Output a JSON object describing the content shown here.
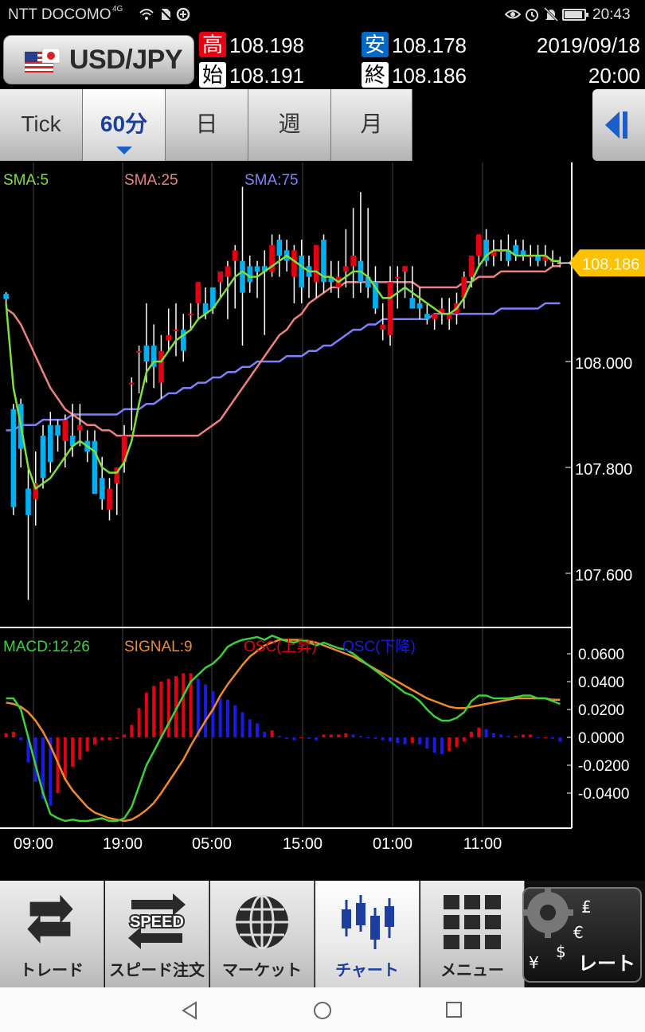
{
  "status_bar": {
    "carrier": "NTT DOCOMO",
    "network_badge": "4G",
    "time": "20:43",
    "icons": [
      "wifi-calling-icon",
      "wifi-icon",
      "no-sim-icon",
      "data-saver-icon",
      "eye-icon",
      "alarm-icon",
      "mute-icon",
      "battery-icon"
    ]
  },
  "header": {
    "pair": "USD/JPY",
    "high_label": "高",
    "high_value": "108.198",
    "low_label": "安",
    "low_value": "108.178",
    "open_label": "始",
    "open_value": "108.191",
    "close_label": "終",
    "close_value": "108.186",
    "date": "2019/09/18",
    "time": "20:00"
  },
  "tabs": [
    {
      "label": "Tick",
      "active": false
    },
    {
      "label": "60分",
      "active": true
    },
    {
      "label": "日",
      "active": false
    },
    {
      "label": "週",
      "active": false
    },
    {
      "label": "月",
      "active": false
    }
  ],
  "chart_data": {
    "type": "candlestick",
    "symbol": "USD/JPY",
    "interval": "60分",
    "legend": [
      "SMA:5",
      "SMA:25",
      "SMA:75"
    ],
    "legend_colors": [
      "#7ee03a",
      "#f08080",
      "#8080ff"
    ],
    "current_price": "108.186",
    "current_price_color": "#ffc000",
    "yticks": [
      "108.000",
      "107.800",
      "107.600"
    ],
    "ylim": [
      107.5,
      108.35
    ],
    "xticks": [
      "09:00",
      "19:00",
      "05:00",
      "15:00",
      "01:00",
      "11:00"
    ],
    "up_color": "#e60012",
    "down_color": "#00b0f0",
    "candles": [
      [
        108.128,
        108.131,
        108.11,
        108.118
      ],
      [
        107.91,
        107.92,
        107.71,
        107.725
      ],
      [
        107.92,
        107.93,
        107.8,
        107.835
      ],
      [
        107.76,
        107.8,
        107.55,
        107.71
      ],
      [
        107.74,
        107.83,
        107.69,
        107.77
      ],
      [
        107.86,
        107.88,
        107.76,
        107.78
      ],
      [
        107.88,
        107.905,
        107.79,
        107.81
      ],
      [
        107.88,
        107.89,
        107.83,
        107.86
      ],
      [
        107.85,
        107.9,
        107.8,
        107.89
      ],
      [
        107.86,
        107.92,
        107.82,
        107.84
      ],
      [
        107.87,
        107.92,
        107.84,
        107.88
      ],
      [
        107.85,
        107.87,
        107.81,
        107.83
      ],
      [
        107.85,
        107.87,
        107.75,
        107.75
      ],
      [
        107.78,
        107.82,
        107.72,
        107.74
      ],
      [
        107.72,
        107.78,
        107.7,
        107.76
      ],
      [
        107.77,
        107.8,
        107.71,
        107.8
      ],
      [
        107.81,
        107.88,
        107.79,
        107.86
      ],
      [
        107.96,
        107.97,
        107.87,
        107.96
      ],
      [
        108.02,
        108.03,
        107.94,
        108.02
      ],
      [
        108.03,
        108.11,
        107.96,
        108.0
      ],
      [
        108.03,
        108.07,
        107.95,
        107.99
      ],
      [
        107.96,
        108.05,
        107.93,
        108.02
      ],
      [
        108.04,
        108.1,
        108.02,
        108.05
      ],
      [
        108.06,
        108.11,
        108.01,
        108.06
      ],
      [
        108.06,
        108.09,
        108.0,
        108.02
      ],
      [
        108.09,
        108.11,
        108.06,
        108.09
      ],
      [
        108.11,
        108.15,
        108.08,
        108.15
      ],
      [
        108.11,
        108.14,
        108.08,
        108.09
      ],
      [
        108.14,
        108.14,
        108.09,
        108.1
      ],
      [
        108.15,
        108.17,
        108.12,
        108.17
      ],
      [
        108.16,
        108.19,
        108.08,
        108.18
      ],
      [
        108.19,
        108.22,
        108.1,
        108.21
      ],
      [
        108.19,
        108.33,
        108.03,
        108.13
      ],
      [
        108.18,
        108.2,
        108.13,
        108.15
      ],
      [
        108.18,
        108.19,
        108.12,
        108.17
      ],
      [
        108.18,
        108.21,
        108.05,
        108.17
      ],
      [
        108.17,
        108.24,
        108.16,
        108.22
      ],
      [
        108.23,
        108.24,
        108.16,
        108.2
      ],
      [
        108.21,
        108.23,
        108.17,
        108.19
      ],
      [
        108.16,
        108.22,
        108.11,
        108.21
      ],
      [
        108.2,
        108.23,
        108.11,
        108.14
      ],
      [
        108.18,
        108.2,
        108.12,
        108.16
      ],
      [
        108.15,
        108.22,
        108.12,
        108.22
      ],
      [
        108.23,
        108.24,
        108.13,
        108.15
      ],
      [
        108.16,
        108.19,
        108.13,
        108.15
      ],
      [
        108.14,
        108.19,
        108.12,
        108.16
      ],
      [
        108.17,
        108.25,
        108.14,
        108.18
      ],
      [
        108.18,
        108.29,
        108.12,
        108.2
      ],
      [
        108.19,
        108.32,
        108.13,
        108.15
      ],
      [
        108.16,
        108.29,
        108.12,
        108.14
      ],
      [
        108.15,
        108.18,
        108.09,
        108.1
      ],
      [
        108.06,
        108.11,
        108.04,
        108.07
      ],
      [
        108.05,
        108.18,
        108.03,
        108.15
      ],
      [
        108.16,
        108.18,
        108.1,
        108.16
      ],
      [
        108.17,
        108.18,
        108.12,
        108.18
      ],
      [
        108.12,
        108.18,
        108.1,
        108.1
      ],
      [
        108.11,
        108.14,
        108.08,
        108.1
      ],
      [
        108.09,
        108.11,
        108.07,
        108.08
      ],
      [
        108.08,
        108.09,
        108.06,
        108.09
      ],
      [
        108.09,
        108.12,
        108.07,
        108.1
      ],
      [
        108.08,
        108.12,
        108.06,
        108.09
      ],
      [
        108.09,
        108.13,
        108.07,
        108.11
      ],
      [
        108.12,
        108.17,
        108.1,
        108.16
      ],
      [
        108.16,
        108.2,
        108.14,
        108.2
      ],
      [
        108.2,
        108.24,
        108.18,
        108.24
      ],
      [
        108.23,
        108.25,
        108.18,
        108.19
      ],
      [
        108.2,
        108.23,
        108.18,
        108.21
      ],
      [
        108.21,
        108.23,
        108.19,
        108.21
      ],
      [
        108.21,
        108.24,
        108.18,
        108.19
      ],
      [
        108.22,
        108.23,
        108.19,
        108.2
      ],
      [
        108.21,
        108.23,
        108.19,
        108.2
      ],
      [
        108.2,
        108.22,
        108.18,
        108.2
      ],
      [
        108.2,
        108.22,
        108.18,
        108.19
      ],
      [
        108.19,
        108.22,
        108.18,
        108.2
      ],
      [
        108.19,
        108.21,
        108.18,
        108.19
      ],
      [
        108.186,
        108.198,
        108.178,
        108.186
      ]
    ],
    "sma5": [
      108.11,
      107.95,
      107.88,
      107.8,
      107.76,
      107.77,
      107.78,
      107.8,
      107.82,
      107.84,
      107.85,
      107.84,
      107.83,
      107.8,
      107.79,
      107.79,
      107.81,
      107.85,
      107.92,
      107.98,
      108.0,
      108.0,
      108.02,
      108.04,
      108.05,
      108.06,
      108.08,
      108.09,
      108.1,
      108.12,
      108.14,
      108.16,
      108.17,
      108.16,
      108.16,
      108.17,
      108.18,
      108.19,
      108.2,
      108.19,
      108.18,
      108.17,
      108.17,
      108.16,
      108.16,
      108.15,
      108.16,
      108.17,
      108.17,
      108.16,
      108.14,
      108.12,
      108.12,
      108.13,
      108.14,
      108.13,
      108.12,
      108.11,
      108.1,
      108.09,
      108.09,
      108.1,
      108.12,
      108.15,
      108.18,
      108.2,
      108.21,
      108.21,
      108.21,
      108.2,
      108.2,
      108.2,
      108.2,
      108.2,
      108.19,
      108.19
    ],
    "sma25": [
      108.1,
      108.09,
      108.07,
      108.04,
      108.01,
      107.98,
      107.95,
      107.93,
      107.91,
      107.9,
      107.89,
      107.88,
      107.88,
      107.87,
      107.87,
      107.86,
      107.86,
      107.86,
      107.86,
      107.86,
      107.86,
      107.86,
      107.86,
      107.86,
      107.86,
      107.86,
      107.86,
      107.87,
      107.88,
      107.89,
      107.91,
      107.93,
      107.95,
      107.97,
      107.99,
      108.01,
      108.03,
      108.05,
      108.06,
      108.08,
      108.09,
      108.11,
      108.12,
      108.13,
      108.14,
      108.14,
      108.15,
      108.15,
      108.15,
      108.15,
      108.15,
      108.15,
      108.15,
      108.15,
      108.15,
      108.15,
      108.14,
      108.14,
      108.14,
      108.14,
      108.14,
      108.14,
      108.15,
      108.15,
      108.16,
      108.16,
      108.16,
      108.17,
      108.17,
      108.17,
      108.17,
      108.17,
      108.17,
      108.17,
      108.18,
      108.18
    ],
    "sma75": [
      107.87,
      107.87,
      107.88,
      107.88,
      107.88,
      107.89,
      107.89,
      107.89,
      107.89,
      107.9,
      107.9,
      107.9,
      107.9,
      107.9,
      107.9,
      107.9,
      107.91,
      107.91,
      107.91,
      107.92,
      107.92,
      107.93,
      107.94,
      107.94,
      107.95,
      107.95,
      107.96,
      107.96,
      107.97,
      107.97,
      107.98,
      107.98,
      107.99,
      107.99,
      108.0,
      108.0,
      108.0,
      108.0,
      108.01,
      108.01,
      108.01,
      108.02,
      108.02,
      108.03,
      108.03,
      108.04,
      108.05,
      108.06,
      108.06,
      108.07,
      108.07,
      108.08,
      108.08,
      108.08,
      108.08,
      108.08,
      108.08,
      108.08,
      108.09,
      108.09,
      108.09,
      108.09,
      108.09,
      108.09,
      108.09,
      108.09,
      108.09,
      108.1,
      108.1,
      108.1,
      108.1,
      108.1,
      108.1,
      108.11,
      108.11,
      108.11
    ],
    "macd_legend": [
      "MACD:12,26",
      "SIGNAL:9",
      "OSC(上昇)",
      "OSC(下降)"
    ],
    "macd_legend_colors": [
      "#3ad13a",
      "#f08a2a",
      "#e60012",
      "#1a1ae6"
    ],
    "macd_yticks": [
      "0.0600",
      "0.0400",
      "0.0200",
      "0.0000",
      "-0.0200",
      "-0.0400"
    ],
    "macd_ylim": [
      -0.06,
      0.075
    ],
    "macd": [
      0.028,
      0.028,
      0.02,
      0.0,
      -0.02,
      -0.04,
      -0.055,
      -0.058,
      -0.06,
      -0.059,
      -0.06,
      -0.06,
      -0.059,
      -0.058,
      -0.06,
      -0.06,
      -0.058,
      -0.05,
      -0.035,
      -0.02,
      -0.01,
      0.0,
      0.01,
      0.02,
      0.03,
      0.04,
      0.045,
      0.05,
      0.053,
      0.058,
      0.065,
      0.068,
      0.07,
      0.071,
      0.072,
      0.07,
      0.073,
      0.071,
      0.069,
      0.068,
      0.07,
      0.068,
      0.066,
      0.068,
      0.066,
      0.064,
      0.063,
      0.06,
      0.056,
      0.052,
      0.048,
      0.044,
      0.04,
      0.036,
      0.032,
      0.03,
      0.026,
      0.02,
      0.015,
      0.012,
      0.012,
      0.014,
      0.018,
      0.026,
      0.03,
      0.03,
      0.028,
      0.028,
      0.028,
      0.029,
      0.03,
      0.03,
      0.028,
      0.028,
      0.026,
      0.024
    ],
    "signal": [
      0.025,
      0.024,
      0.022,
      0.018,
      0.012,
      0.004,
      -0.006,
      -0.018,
      -0.03,
      -0.038,
      -0.044,
      -0.05,
      -0.054,
      -0.056,
      -0.058,
      -0.059,
      -0.06,
      -0.059,
      -0.056,
      -0.052,
      -0.047,
      -0.04,
      -0.032,
      -0.024,
      -0.016,
      -0.006,
      0.003,
      0.012,
      0.02,
      0.03,
      0.038,
      0.045,
      0.052,
      0.058,
      0.062,
      0.066,
      0.068,
      0.07,
      0.07,
      0.07,
      0.07,
      0.069,
      0.068,
      0.066,
      0.064,
      0.062,
      0.06,
      0.058,
      0.055,
      0.052,
      0.049,
      0.046,
      0.043,
      0.04,
      0.037,
      0.034,
      0.031,
      0.028,
      0.026,
      0.024,
      0.022,
      0.021,
      0.021,
      0.022,
      0.023,
      0.024,
      0.025,
      0.026,
      0.027,
      0.028,
      0.028,
      0.028,
      0.028,
      0.028,
      0.027,
      0.027
    ],
    "osc": [
      0.003,
      0.004,
      -0.002,
      -0.018,
      -0.032,
      -0.044,
      -0.049,
      -0.04,
      -0.03,
      -0.021,
      -0.016,
      -0.01,
      -0.005,
      -0.002,
      -0.002,
      -0.001,
      0.002,
      0.009,
      0.021,
      0.032,
      0.037,
      0.04,
      0.042,
      0.044,
      0.046,
      0.046,
      0.042,
      0.038,
      0.033,
      0.028,
      0.027,
      0.023,
      0.018,
      0.013,
      0.01,
      0.004,
      0.005,
      0.001,
      -0.001,
      -0.002,
      0.0,
      -0.001,
      -0.002,
      0.002,
      0.002,
      0.002,
      0.003,
      0.002,
      0.001,
      0.0,
      -0.001,
      -0.002,
      -0.003,
      -0.004,
      -0.005,
      -0.004,
      -0.005,
      -0.008,
      -0.011,
      -0.012,
      -0.01,
      -0.007,
      -0.003,
      0.004,
      0.007,
      0.006,
      0.003,
      0.002,
      0.001,
      0.001,
      0.002,
      0.002,
      0.0,
      0.0,
      -0.001,
      -0.003
    ],
    "osc_labels": null
  },
  "bottom_nav": [
    {
      "label": "トレード",
      "icon": "trade-arrows-icon"
    },
    {
      "label": "スピード注文",
      "icon": "speed-order-icon",
      "icon_text": "SPEED"
    },
    {
      "label": "マーケット",
      "icon": "globe-icon"
    },
    {
      "label": "チャート",
      "icon": "candlestick-icon",
      "active": true
    },
    {
      "label": "メニュー",
      "icon": "grid-menu-icon"
    },
    {
      "label": "レート",
      "icon": "gear-currency-icon"
    }
  ],
  "system_nav": [
    "back-icon",
    "home-icon",
    "recents-icon"
  ]
}
